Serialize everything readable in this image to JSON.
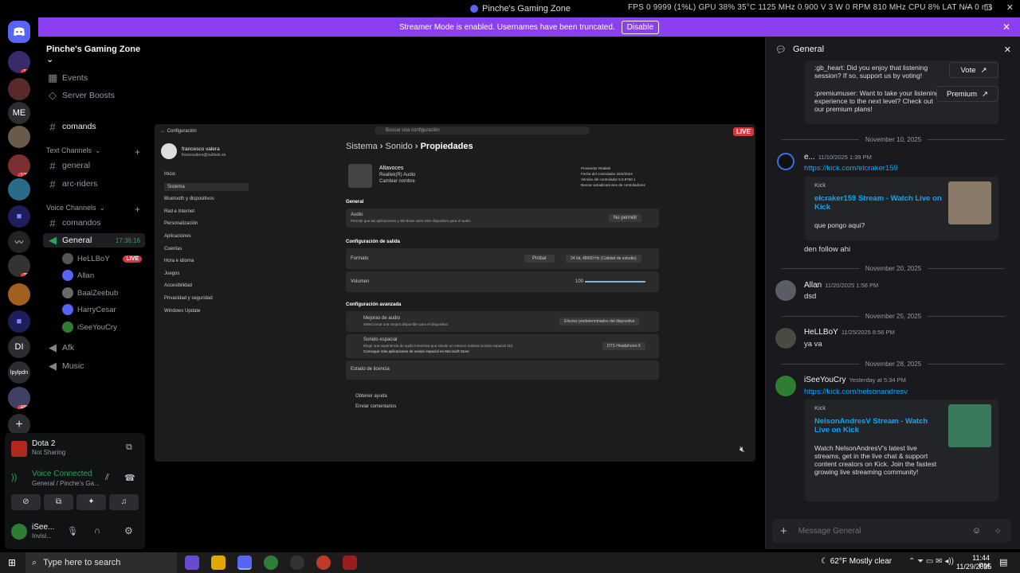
{
  "titlebar": {
    "title": "Pinche's Gaming Zone",
    "stats": "FPS  0   9999 (1%L)   GPU 38% 35°C 1125 MHz 0.900 V 3 W 0 RPM 810 MHz   CPU 8%   LAT N/A 0 ms"
  },
  "banner": {
    "text": "Streamer Mode is enabled. Usernames have been truncated.",
    "disable_label": "Disable"
  },
  "rail": {
    "badges": [
      "10",
      "123",
      "35",
      "482"
    ],
    "labels": [
      "ME",
      "DI",
      "lpylpdn"
    ]
  },
  "sidebar": {
    "guild_name": "Pinche's Gaming Zone",
    "items": [
      {
        "label": "Events"
      },
      {
        "label": "Server Boosts"
      },
      {
        "label": "comands"
      }
    ],
    "text_category": "Text Channels",
    "text_channels": [
      "general",
      "arc-riders"
    ],
    "voice_category": "Voice Channels",
    "voice_channels": [
      "comandos",
      "General",
      "Afk",
      "Music"
    ],
    "general_timer": "17:36:16",
    "voice_users": [
      "HeLLBoY",
      "Allan",
      "BaalZeebub",
      "HarryCesar",
      "iSeeYouCry"
    ],
    "live_label": "LIVE"
  },
  "panel": {
    "game_title": "Dota 2",
    "game_sub": "Not Sharing",
    "voice_status": "Voice Connected",
    "voice_sub": "General / Pinche's Ga...",
    "user_name": "iSee...",
    "user_status": "Invisi..."
  },
  "stream": {
    "live_label": "LIVE",
    "win_title": "Configuración",
    "search_placeholder": "Buscar una configuración",
    "profile_name": "francesco valera",
    "profile_email": "francovalera@outlook.es",
    "nav": [
      "Inicio",
      "Sistema",
      "Bluetooth y dispositivos",
      "Red e Internet",
      "Personalización",
      "Aplicaciones",
      "Cuentas",
      "Hora e idioma",
      "Juegos",
      "Accesibilidad",
      "Privacidad y seguridad",
      "Windows Update"
    ],
    "breadcrumb": [
      "Sistema",
      "Sonido",
      "Propiedades"
    ],
    "device_name": "Altavoces",
    "device_sub": "Realtek(R) Audio",
    "device_rename": "Cambiar nombre",
    "device_info": [
      "Proveedor  Realtek",
      "Fecha del controlador  25/4/2024",
      "Versión del controlador  6.0.9760.1",
      "Buscar actualizaciones de controladores"
    ],
    "section_general": "General",
    "audio_label": "Audio",
    "audio_desc": "Permitir que las aplicaciones y Windows usen este dispositivo para el audio",
    "no_permitir": "No permitir",
    "section_output": "Configuración de salida",
    "formato": "Formato",
    "probar": "Probar",
    "formato_value": "24 bit, 48000 Hz (Calidad de estudio)",
    "volumen": "Volumen",
    "volumen_value": "100",
    "section_advanced": "Configuración avanzada",
    "mejoras": "Mejoras de audio",
    "mejoras_desc": "Seleccionar una mejora disponible para el dispositivo",
    "mejoras_value": "Efectos predeterminados del dispositivo",
    "espacial": "Sonido espacial",
    "espacial_desc": "Elegir una experiencia de audio inmersiva que simule un entorno realista (sonido espacial 3D)",
    "espacial_link": "Conseguir más aplicaciones de sonido espacial en Microsoft Store",
    "espacial_value": "DTS Headphone:X",
    "licencia": "Estado de licencia",
    "ayuda": "Obtener ayuda",
    "comentarios": "Enviar comentarios"
  },
  "chat": {
    "channel": "General",
    "top_card": {
      "line1": ":gb_heart: Did you enjoy that listening session? If so, support us by voting!",
      "vote": "Vote",
      "line2": ":premiumuser: Want to take your listening experience to the next level? Check out our premium plans!",
      "premium": "Premium"
    },
    "dates": [
      "November 10, 2025",
      "November 20, 2025",
      "November 25, 2025",
      "November 28, 2025"
    ],
    "messages": [
      {
        "name": "e...",
        "time": "11/10/2025 1:39 PM",
        "link": "https://kick.com/elcraker159"
      },
      {
        "name": "Allan",
        "time": "11/20/2025 1:58 PM",
        "text": "dsd"
      },
      {
        "name": "HeLLBoY",
        "time": "11/25/2025 8:56 PM",
        "text": "ya va"
      },
      {
        "name": "iSeeYouCry",
        "time": "Yesterday at 5:34 PM",
        "link": "https://kick.com/nelsonandresv"
      }
    ],
    "embed1": {
      "provider": "Kick",
      "title": "elcraker159 Stream - Watch Live on Kick",
      "desc": "que pongo aqui?"
    },
    "followup": "den follow ahi",
    "embed2": {
      "provider": "Kick",
      "title": "NelsonAndresV Stream - Watch Live on Kick",
      "desc": "Watch NelsonAndresV's latest live streams, get in the live chat & support content creators on Kick. Join the fastest growing live streaming community!"
    },
    "input_placeholder": "Message General"
  },
  "taskbar": {
    "search": "Type here to search",
    "weather": "62°F  Mostly clear",
    "time": "11:44 PM",
    "date": "11/29/2025"
  }
}
